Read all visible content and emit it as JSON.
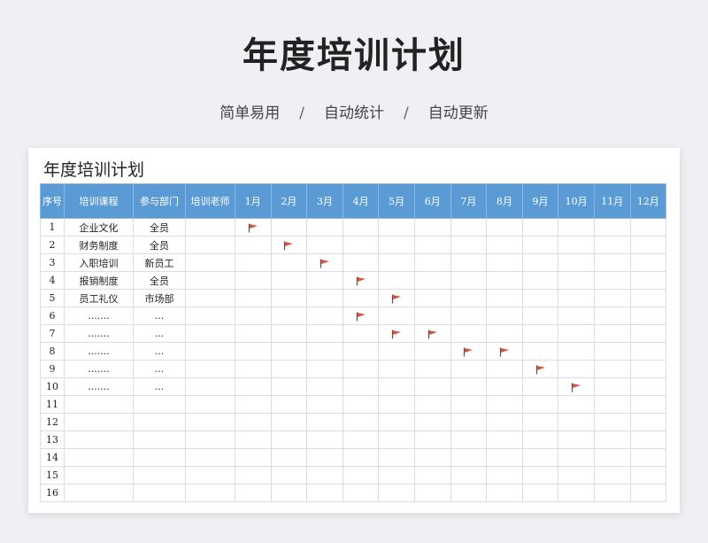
{
  "header": {
    "title": "年度培训计划",
    "subtitle": [
      "简单易用",
      "自动统计",
      "自动更新"
    ],
    "separator": "/"
  },
  "sheet": {
    "title": "年度培训计划",
    "columns": [
      "序号",
      "培训课程",
      "参与部门",
      "培训老师",
      "1月",
      "2月",
      "3月",
      "4月",
      "5月",
      "6月",
      "7月",
      "8月",
      "9月",
      "10月",
      "11月",
      "12月"
    ],
    "rows": [
      {
        "no": "1",
        "course": "企业文化",
        "dept": "全员",
        "teacher": "",
        "months": [
          1
        ]
      },
      {
        "no": "2",
        "course": "财务制度",
        "dept": "全员",
        "teacher": "",
        "months": [
          2
        ]
      },
      {
        "no": "3",
        "course": "入职培训",
        "dept": "新员工",
        "teacher": "",
        "months": [
          3
        ]
      },
      {
        "no": "4",
        "course": "报销制度",
        "dept": "全员",
        "teacher": "",
        "months": [
          4
        ]
      },
      {
        "no": "5",
        "course": "员工礼仪",
        "dept": "市场部",
        "teacher": "",
        "months": [
          5
        ]
      },
      {
        "no": "6",
        "course": ".......",
        "dept": "...",
        "teacher": "",
        "months": [
          4
        ]
      },
      {
        "no": "7",
        "course": ".......",
        "dept": "...",
        "teacher": "",
        "months": [
          5,
          6
        ]
      },
      {
        "no": "8",
        "course": ".......",
        "dept": "...",
        "teacher": "",
        "months": [
          7,
          8
        ]
      },
      {
        "no": "9",
        "course": ".......",
        "dept": "...",
        "teacher": "",
        "months": [
          9
        ]
      },
      {
        "no": "10",
        "course": ".......",
        "dept": "...",
        "teacher": "",
        "months": [
          10
        ]
      },
      {
        "no": "11",
        "course": "",
        "dept": "",
        "teacher": "",
        "months": []
      },
      {
        "no": "12",
        "course": "",
        "dept": "",
        "teacher": "",
        "months": []
      },
      {
        "no": "13",
        "course": "",
        "dept": "",
        "teacher": "",
        "months": []
      },
      {
        "no": "14",
        "course": "",
        "dept": "",
        "teacher": "",
        "months": []
      },
      {
        "no": "15",
        "course": "",
        "dept": "",
        "teacher": "",
        "months": []
      },
      {
        "no": "16",
        "course": "",
        "dept": "",
        "teacher": "",
        "months": []
      }
    ],
    "flag_icon": "flag-icon",
    "colors": {
      "header_bg": "#5b9bd5",
      "flag": "#d9533c",
      "pole": "#555555"
    }
  }
}
